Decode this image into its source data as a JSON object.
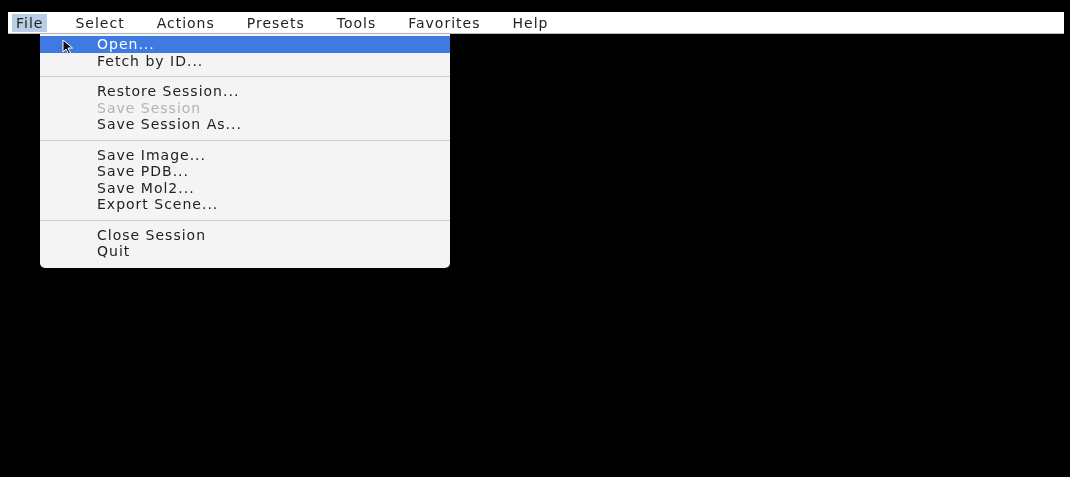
{
  "menu_bar": [
    {
      "label": "File",
      "selected": true
    },
    {
      "label": "Select",
      "selected": false
    },
    {
      "label": "Actions",
      "selected": false
    },
    {
      "label": "Presets",
      "selected": false
    },
    {
      "label": "Tools",
      "selected": false
    },
    {
      "label": "Favorites",
      "selected": false
    },
    {
      "label": "Help",
      "selected": false
    }
  ],
  "file_menu": {
    "groups": [
      [
        {
          "label": "Open...",
          "selected": true,
          "disabled": false
        },
        {
          "label": "Fetch by ID...",
          "selected": false,
          "disabled": false
        }
      ],
      [
        {
          "label": "Restore Session...",
          "selected": false,
          "disabled": false
        },
        {
          "label": "Save Session",
          "selected": false,
          "disabled": true
        },
        {
          "label": "Save Session As...",
          "selected": false,
          "disabled": false
        }
      ],
      [
        {
          "label": "Save Image...",
          "selected": false,
          "disabled": false
        },
        {
          "label": "Save PDB...",
          "selected": false,
          "disabled": false
        },
        {
          "label": "Save Mol2...",
          "selected": false,
          "disabled": false
        },
        {
          "label": "Export Scene...",
          "selected": false,
          "disabled": false
        }
      ],
      [
        {
          "label": "Close Session",
          "selected": false,
          "disabled": false
        },
        {
          "label": "Quit",
          "selected": false,
          "disabled": false
        }
      ]
    ]
  }
}
